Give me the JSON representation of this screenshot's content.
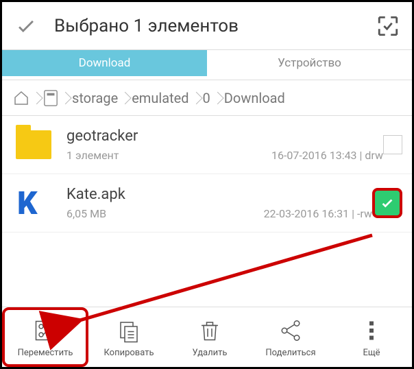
{
  "header": {
    "title": "Выбрано 1 элементов"
  },
  "tabs": {
    "active": "Download",
    "other": "Устройство"
  },
  "breadcrumb": [
    "storage",
    "emulated",
    "0",
    "Download"
  ],
  "items": [
    {
      "name": "geotracker",
      "subtitle": "1 элемент",
      "date": "16-07-2016 13:43 | drw",
      "type": "folder",
      "selected": false
    },
    {
      "name": "Kate.apk",
      "subtitle": "6,05 MB",
      "date": "22-03-2016 16:31 | -rw",
      "type": "apk",
      "selected": true
    }
  ],
  "toolbar": [
    {
      "id": "move",
      "label": "Переместить",
      "highlight": true
    },
    {
      "id": "copy",
      "label": "Копировать",
      "highlight": false
    },
    {
      "id": "delete",
      "label": "Удалить",
      "highlight": false
    },
    {
      "id": "share",
      "label": "Поделиться",
      "highlight": false
    },
    {
      "id": "more",
      "label": "Ещё",
      "highlight": false
    }
  ]
}
